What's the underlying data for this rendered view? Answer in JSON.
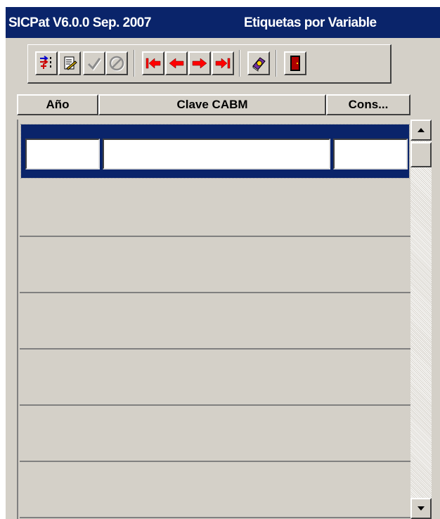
{
  "window": {
    "app_title": "SICPat V6.0.0 Sep. 2007",
    "form_title": "Etiquetas por Variable"
  },
  "toolbar": {
    "buttons": [
      {
        "name": "insert-record",
        "icon": "insert-icon",
        "enabled": true
      },
      {
        "name": "edit-record",
        "icon": "edit-document-icon",
        "enabled": true
      },
      {
        "name": "confirm",
        "icon": "checkmark-icon",
        "enabled": false
      },
      {
        "name": "cancel",
        "icon": "cancel-icon",
        "enabled": false
      },
      {
        "name": "first-record",
        "icon": "first-record-icon",
        "enabled": true
      },
      {
        "name": "previous-record",
        "icon": "previous-record-icon",
        "enabled": true
      },
      {
        "name": "next-record",
        "icon": "next-record-icon",
        "enabled": true
      },
      {
        "name": "last-record",
        "icon": "last-record-icon",
        "enabled": true
      },
      {
        "name": "help",
        "icon": "help-book-icon",
        "enabled": true
      },
      {
        "name": "exit",
        "icon": "exit-door-icon",
        "enabled": true
      }
    ]
  },
  "table": {
    "columns": [
      "Año",
      "Clave CABM",
      "Cons..."
    ],
    "rows": [
      {
        "values": [
          "",
          "",
          ""
        ],
        "current": true
      },
      {
        "values": [],
        "current": false
      },
      {
        "values": [],
        "current": false
      },
      {
        "values": [],
        "current": false
      },
      {
        "values": [],
        "current": false
      },
      {
        "values": [],
        "current": false
      },
      {
        "values": [],
        "current": false
      }
    ]
  },
  "colors": {
    "titlebar": "#0a246a",
    "face": "#d4d0c8",
    "arrow_red": "#ff0000"
  }
}
